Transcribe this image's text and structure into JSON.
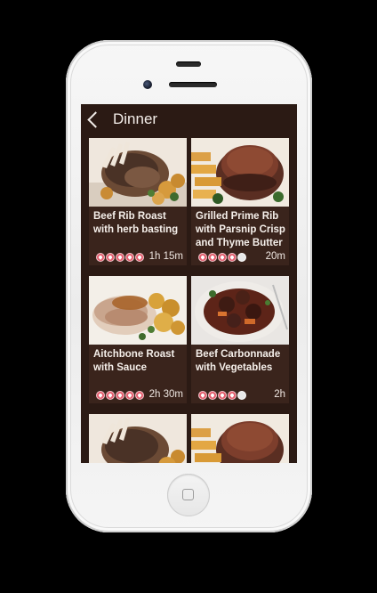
{
  "header": {
    "title": "Dinner"
  },
  "recipes": [
    {
      "name": "Beef Rib Roast with herb basting",
      "time": "1h 15m",
      "rating": 5
    },
    {
      "name": "Grilled Prime Rib with Parsnip Crisp and Thyme Butter",
      "time": "20m",
      "rating": 4
    },
    {
      "name": "Aitchbone Roast with Sauce",
      "time": "2h 30m",
      "rating": 5
    },
    {
      "name": "Beef Carbonnade with Vegetables",
      "time": "2h",
      "rating": 4
    },
    {
      "name": "",
      "time": "",
      "rating": 0
    },
    {
      "name": "",
      "time": "",
      "rating": 0
    }
  ],
  "colors": {
    "screen_bg": "#2b1a14",
    "card_bg": "#3a241c",
    "heart_filled": "#e35f6e",
    "heart_empty": "#e8e8e8"
  },
  "icons": {
    "back": "chevron-left-icon",
    "home": "home-button-icon"
  }
}
